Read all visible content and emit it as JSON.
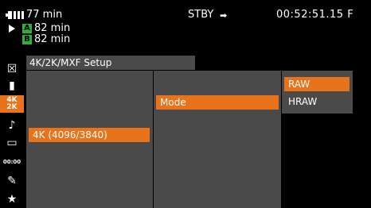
{
  "status": {
    "battery_time": "77 min",
    "slot_a_label": "A",
    "slot_a_time": "82 min",
    "slot_b_label": "B",
    "slot_b_time": "82 min",
    "mode": "STBY",
    "timecode": "00:52:51.15 F"
  },
  "sidebar": {
    "items": [
      {
        "icon": "close-icon",
        "glyph": "☒"
      },
      {
        "icon": "camera-icon",
        "glyph": "▮"
      },
      {
        "icon": "4k-2k-icon",
        "glyph": "4K"
      },
      {
        "icon": "audio-icon",
        "glyph": "♪"
      },
      {
        "icon": "media-icon",
        "glyph": "▭"
      },
      {
        "icon": "timecode-icon",
        "glyph": "00:00"
      },
      {
        "icon": "wrench-icon",
        "glyph": "✎"
      },
      {
        "icon": "star-icon",
        "glyph": "★"
      }
    ]
  },
  "menu": {
    "title": "4K/2K/MXF Setup",
    "level1_selected": "4K (4096/3840)",
    "level2_selected": "Mode",
    "options": [
      "RAW",
      "HRAW"
    ],
    "selected_option": "RAW"
  },
  "colors": {
    "accent": "#e8731a",
    "panel": "#4a4a4a",
    "slot": "#2fae3a"
  }
}
